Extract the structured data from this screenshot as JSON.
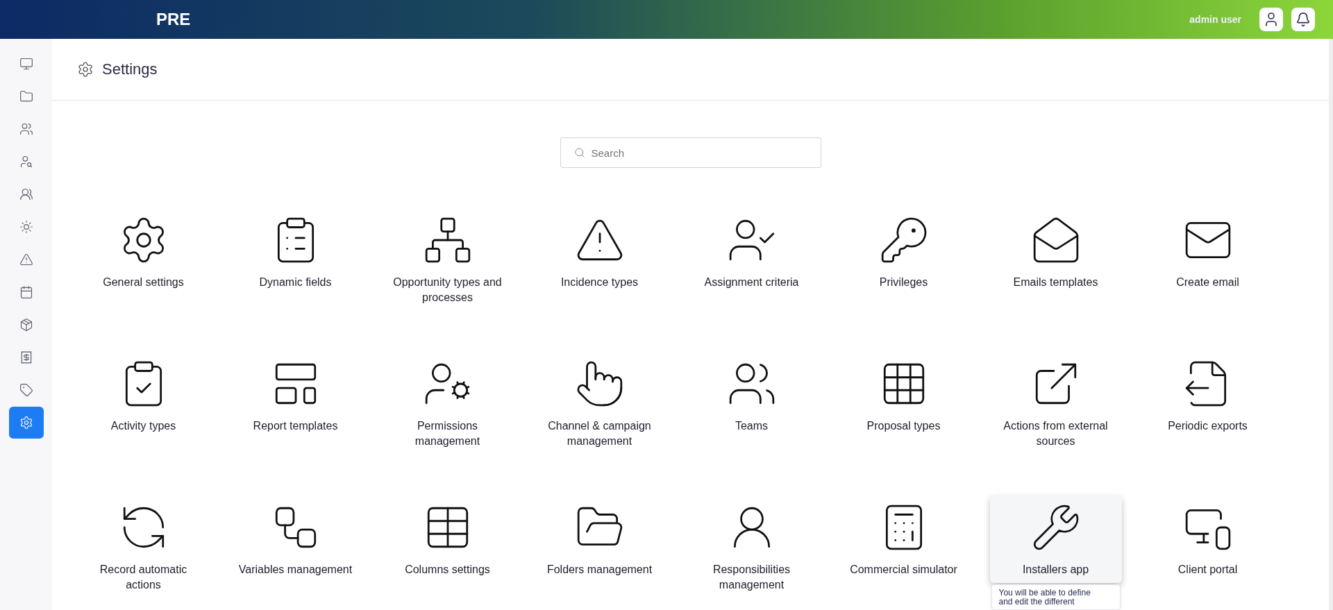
{
  "topbar": {
    "brand": "PRE",
    "user_name": "admin user"
  },
  "sidebar": {
    "items": [
      {
        "selected": false
      },
      {
        "selected": false
      },
      {
        "selected": false
      },
      {
        "selected": false
      },
      {
        "selected": false
      },
      {
        "selected": false
      },
      {
        "selected": false
      },
      {
        "selected": false
      },
      {
        "selected": false
      },
      {
        "selected": false
      },
      {
        "selected": false
      },
      {
        "selected": true
      }
    ]
  },
  "page": {
    "title": "Settings"
  },
  "search": {
    "placeholder": "Search"
  },
  "settings_items": [
    {
      "label": "General settings",
      "hovered": false
    },
    {
      "label": "Dynamic fields",
      "hovered": false
    },
    {
      "label": "Opportunity types and\nprocesses",
      "hovered": false
    },
    {
      "label": "Incidence types",
      "hovered": false
    },
    {
      "label": "Assignment criteria",
      "hovered": false
    },
    {
      "label": "Privileges",
      "hovered": false
    },
    {
      "label": "Emails templates",
      "hovered": false
    },
    {
      "label": "Create email",
      "hovered": false
    },
    {
      "label": "Activity types",
      "hovered": false
    },
    {
      "label": "Report templates",
      "hovered": false
    },
    {
      "label": "Permissions\nmanagement",
      "hovered": false
    },
    {
      "label": "Channel & campaign\nmanagement",
      "hovered": false
    },
    {
      "label": "Teams",
      "hovered": false
    },
    {
      "label": "Proposal types",
      "hovered": false
    },
    {
      "label": "Actions from external\nsources",
      "hovered": false
    },
    {
      "label": "Periodic exports",
      "hovered": false
    },
    {
      "label": "Record automatic\nactions",
      "hovered": false
    },
    {
      "label": "Variables management",
      "hovered": false
    },
    {
      "label": "Columns settings",
      "hovered": false
    },
    {
      "label": "Folders management",
      "hovered": false
    },
    {
      "label": "Responsibilities\nmanagement",
      "hovered": false
    },
    {
      "label": "Commercial simulator",
      "hovered": false
    },
    {
      "label": "Installers app",
      "hovered": true,
      "tooltip": "You will be able to define\nand edit the different"
    },
    {
      "label": "Client portal",
      "hovered": false
    }
  ]
}
